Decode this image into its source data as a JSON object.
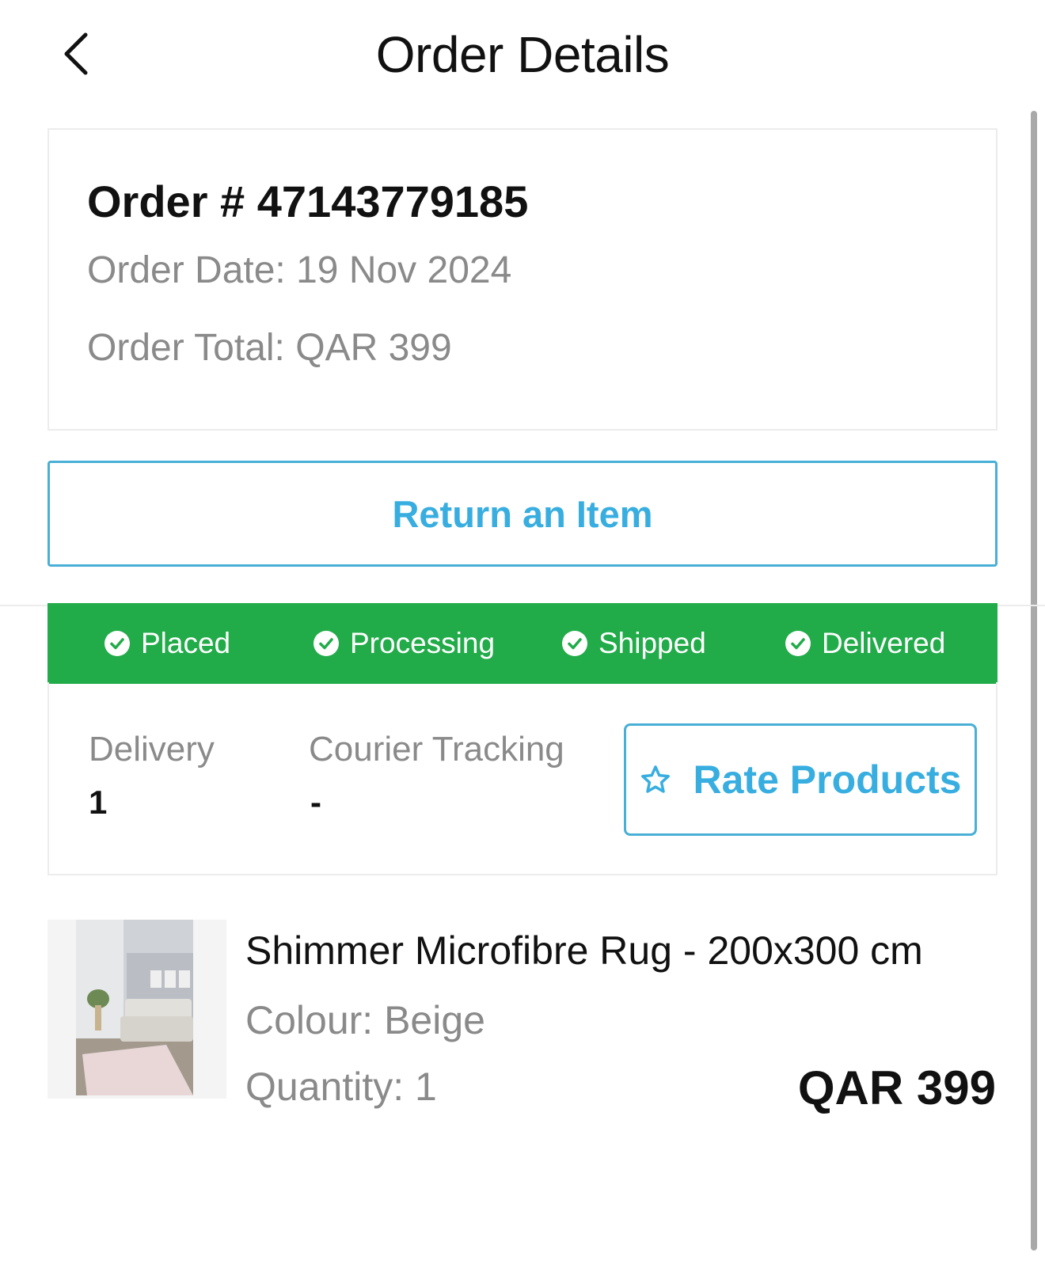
{
  "header": {
    "title": "Order Details",
    "back_icon": "chevron-left-icon"
  },
  "order": {
    "number": "Order # 47143779185",
    "date": "Order Date: 19 Nov 2024",
    "total": "Order Total: QAR 399"
  },
  "actions": {
    "return_label": "Return an Item",
    "rate_label": "Rate Products",
    "rate_icon": "star-outline-icon",
    "accent_color": "#38aee0"
  },
  "status": {
    "color": "#21ab49",
    "steps": [
      {
        "label": "Placed",
        "icon": "check-circle-icon"
      },
      {
        "label": "Processing",
        "icon": "check-circle-icon"
      },
      {
        "label": "Shipped",
        "icon": "check-circle-icon"
      },
      {
        "label": "Delivered",
        "icon": "check-circle-icon"
      }
    ]
  },
  "delivery": {
    "delivery_label": "Delivery",
    "delivery_value": "1",
    "tracking_label": "Courier Tracking",
    "tracking_value": "-"
  },
  "product": {
    "name": "Shimmer Microfibre Rug - 200x300 cm",
    "colour": "Colour: Beige",
    "quantity": "Quantity: 1",
    "price": "QAR 399"
  }
}
